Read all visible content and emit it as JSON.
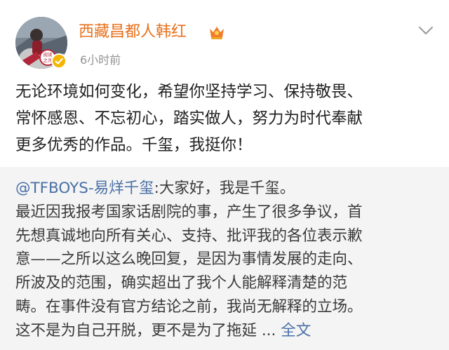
{
  "post": {
    "author": {
      "name": "西藏昌都人韩红",
      "avatar_badge_text": "阅读之光",
      "verified_icon": "verified-icon",
      "member_icon": "crown-icon"
    },
    "time": "6小时前",
    "menu_icon": "chevron-down-icon",
    "text_lines": [
      "无论环境如何变化，希望你坚持学习、保持敬畏、",
      "常怀感恩、不忘初心，踏实做人，努力为时代奉献",
      "更多优秀的作品。千玺，我挺你！"
    ]
  },
  "repost": {
    "mention": "@TFBOYS-易烊千玺",
    "first_line_rest": ":大家好，我是千玺。",
    "text_lines": [
      "最近因我报考国家话剧院的事，产生了很多争议，首",
      "先想真诚地向所有关心、支持、批评我的各位表示歉",
      "意——之所以这么晚回复，是因为事情发展的走向、",
      "所波及的范围，确实超出了我个人能解释清楚的范",
      "畴。在事件没有官方结论之前，我尚无解释的立场。"
    ],
    "last_line": "这不是为自己开脱，更不是为了拖延 ...",
    "more_link": "全文"
  },
  "colors": {
    "author_name": "#e8711c",
    "link": "#4a6fa5",
    "repost_background": "#f4f4f4",
    "verified": "#f4b400",
    "muted": "#939393"
  }
}
